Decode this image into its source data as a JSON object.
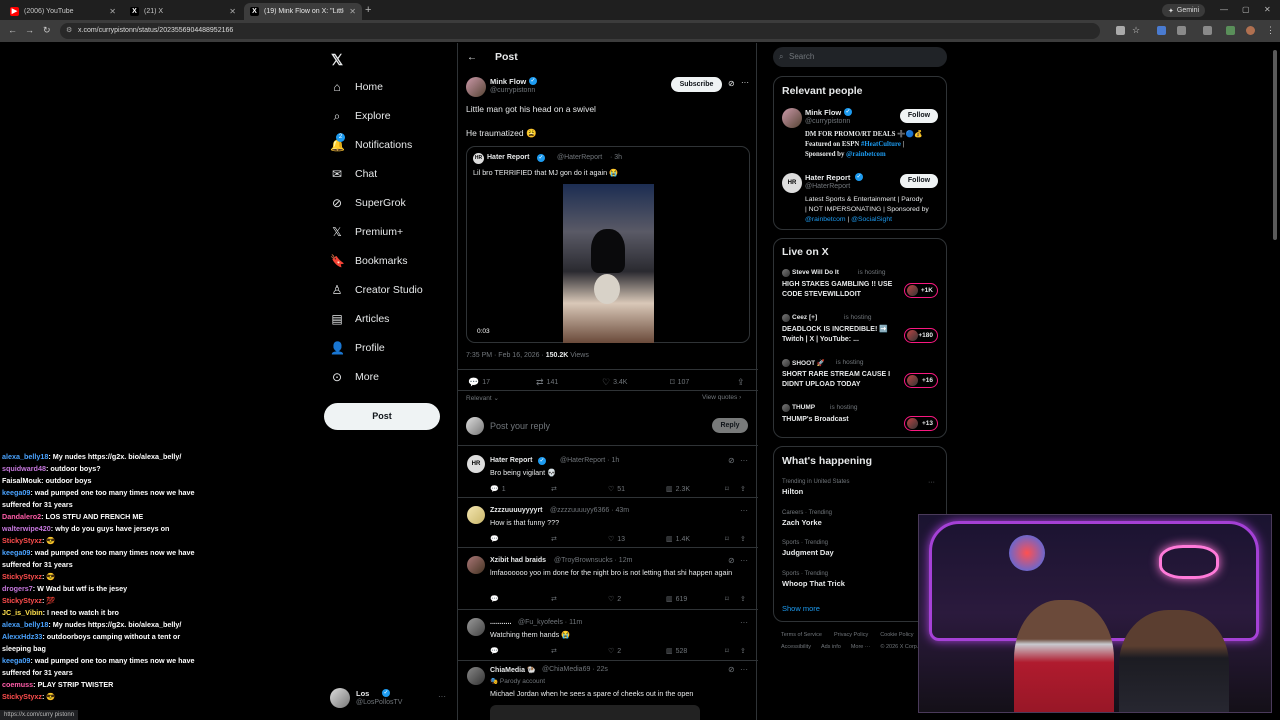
{
  "browser": {
    "tabs": [
      {
        "label": "(2006) YouTube",
        "color": "#ff0000",
        "glyph": "▶"
      },
      {
        "label": "(21) X",
        "color": "#000000",
        "glyph": "X"
      },
      {
        "label": "(19) Mink Flow on X: \"Little ma",
        "color": "#000000",
        "glyph": "X"
      }
    ],
    "new_tab": "+",
    "url": "x.com/currypistonn/status/2023556904488952166",
    "gemini": "Gemini"
  },
  "nav": {
    "items": [
      "Home",
      "Explore",
      "Notifications",
      "Chat",
      "SuperGrok",
      "Premium+",
      "Bookmarks",
      "Creator Studio",
      "Articles",
      "Profile",
      "More"
    ],
    "notif_badge": "2",
    "post_button": "Post",
    "account_name": "Los",
    "account_handle": "@LosPollosTV"
  },
  "header": {
    "title": "Post"
  },
  "post": {
    "author": "Mink Flow",
    "handle": "@currypistonn",
    "subscribe": "Subscribe",
    "line1": "Little man got his head on a swivel",
    "line2": "He traumatized 😩",
    "quote": {
      "author": "Hater Report",
      "handle": "@HaterReport",
      "time": "· 3h",
      "text": "Lil bro TERRIFIED that MJ gon do it again 😭",
      "video_time": "0:03"
    },
    "timestamp": "7:35 PM · Feb 16, 2026 · ",
    "views_count": "150.2K",
    "views_label": " Views",
    "stats": {
      "replies": "17",
      "reposts": "141",
      "likes": "3.4K",
      "bookmarks": "107"
    },
    "relevant": "Relevant ⌄",
    "view_quotes": "View quotes ›"
  },
  "reply_box": {
    "placeholder": "Post your reply",
    "button": "Reply"
  },
  "replies": [
    {
      "author": "Hater Report",
      "handle": "@HaterReport · 1h",
      "text": "Bro being vigilant 💀",
      "r": "1",
      "rt": "",
      "l": "51",
      "v": "2.3K"
    },
    {
      "author": "Zzzzuuuuyyyyrt",
      "handle": "@zzzzuuuuyy6366 · 43m",
      "text": "How is that funny ???",
      "r": "",
      "rt": "",
      "l": "13",
      "v": "1.4K"
    },
    {
      "author": "Xzibit had braids",
      "handle": "@TroyBrownsucks · 12m",
      "text": "lmfaoooooo yoo im done for the night bro is not letting that shi happen again",
      "r": "",
      "rt": "",
      "l": "2",
      "v": "619"
    },
    {
      "author": "...........",
      "handle": "@Fu_kyofeels · 11m",
      "text": "Watching them hands 😭",
      "r": "",
      "rt": "",
      "l": "2",
      "v": "528"
    },
    {
      "author": "ChiaMedia 🐏",
      "handle": "@ChiaMedia69 · 22s",
      "sub": "🎭 Parody account",
      "text": "Michael Jordan when he sees a spare of cheeks out in the open"
    }
  ],
  "right": {
    "search_placeholder": "Search",
    "relevant_title": "Relevant people",
    "people": [
      {
        "name": "Mink Flow",
        "handle": "@currypistonn",
        "follow": "Follow",
        "bio1": "DM FOR PROMO/RT DEALS ➕🔵💰",
        "bio2a": "Featured on ESPN ",
        "bio2b": "#HeatCulture",
        "bio2c": " |",
        "bio3a": "Sponsored by ",
        "bio3b": "@rainbetcom"
      },
      {
        "name": "Hater Report",
        "handle": "@HaterReport",
        "follow": "Follow",
        "bio1": "Latest Sports & Entertainment | Parody",
        "bio2a": "| NOT IMPERSONATING | Sponsored by",
        "bio3b": "@rainbetcom",
        "bio3c": " | ",
        "bio3d": "@SocialSight"
      }
    ],
    "live_title": "Live on X",
    "live": [
      {
        "host": "Steve Will Do It",
        "hosting": "is hosting",
        "title": "HIGH STAKES GAMBLING !! USE CODE STEVEWILLDOIT",
        "count": "+1K"
      },
      {
        "host": "Ceez [+]",
        "hosting": "is hosting",
        "title": "DEADLOCK IS INCREDIBLE! ➡️ Twitch | X | YouTube: ...",
        "count": "+180"
      },
      {
        "host": "SHOOT 🚀",
        "hosting": "is hosting",
        "title": "SHORT RARE STREAM CAUSE I DIDNT UPLOAD TODAY",
        "count": "+16"
      },
      {
        "host": "THUMP",
        "hosting": "is hosting",
        "title": "THUMP's Broadcast",
        "count": "+13"
      }
    ],
    "happening_title": "What's happening",
    "trends": [
      {
        "ctx": "Trending in United States",
        "name": "Hilton"
      },
      {
        "ctx": "Careers · Trending",
        "name": "Zach Yorke"
      },
      {
        "ctx": "Sports · Trending",
        "name": "Judgment Day"
      },
      {
        "ctx": "Sports · Trending",
        "name": "Whoop That Trick"
      }
    ],
    "show_more": "Show more",
    "footer1": [
      "Terms of Service",
      "Privacy Policy",
      "Cookie Policy"
    ],
    "footer2": [
      "Accessibility",
      "Ads info",
      "More ···",
      "© 2026 X Corp."
    ]
  },
  "chat": [
    {
      "user": "alexa_belly18",
      "color": "#4aa3ff",
      "msg": "My nudes https://g2x. bio/alexa_belly/"
    },
    {
      "user": "squidward48",
      "color": "#c678dd",
      "msg": "outdoor boys?",
      "badge": true
    },
    {
      "user": "FaisalMouk",
      "color": "#ffffff",
      "msg": "outdoor boys"
    },
    {
      "user": "keega09",
      "color": "#4aa3ff",
      "msg": "wad pumped one too many times now we have"
    },
    {
      "user": "",
      "color": "#ffffff",
      "msg": "suffered for 31 years"
    },
    {
      "user": "Dandalero2",
      "color": "#ff5ca8",
      "msg": "LOS STFU AND FRENCH ME"
    },
    {
      "user": "walterwipe420",
      "color": "#c678dd",
      "msg": "why do you guys have jerseys on",
      "badge": true
    },
    {
      "user": "StickyStyxz",
      "color": "#ff4d4d",
      "msg": "😎"
    },
    {
      "user": "keega09",
      "color": "#4aa3ff",
      "msg": "wad pumped one too many times now we have"
    },
    {
      "user": "",
      "color": "#ffffff",
      "msg": "suffered for 31 years"
    },
    {
      "user": "StickyStyxz",
      "color": "#ff4d4d",
      "msg": "😎"
    },
    {
      "user": "drogers7",
      "color": "#c678dd",
      "msg": "W Wad but wtf is the jesey"
    },
    {
      "user": "StickyStyxz",
      "color": "#ff4d4d",
      "msg": "💯"
    },
    {
      "user": "JC_is_Vibin",
      "color": "#ffe14d",
      "msg": "I need to watch it bro"
    },
    {
      "user": "alexa_belly18",
      "color": "#4aa3ff",
      "msg": "My nudes https://g2x. bio/alexa_belly/"
    },
    {
      "user": "AlexxHdz33",
      "color": "#4aa3ff",
      "msg": "outdoorboys camping without a tent or"
    },
    {
      "user": "",
      "color": "#ffffff",
      "msg": "sleeping bag"
    },
    {
      "user": "keega09",
      "color": "#4aa3ff",
      "msg": "wad pumped one too many times now we have"
    },
    {
      "user": "",
      "color": "#ffffff",
      "msg": "suffered for 31 years"
    },
    {
      "user": "coemuss",
      "color": "#ff5ca8",
      "msg": "PLAY STRIP TWISTER"
    },
    {
      "user": "StickyStyxz",
      "color": "#ff4d4d",
      "msg": "😎"
    }
  ],
  "status_url": "https://x.com/curry pistonn"
}
